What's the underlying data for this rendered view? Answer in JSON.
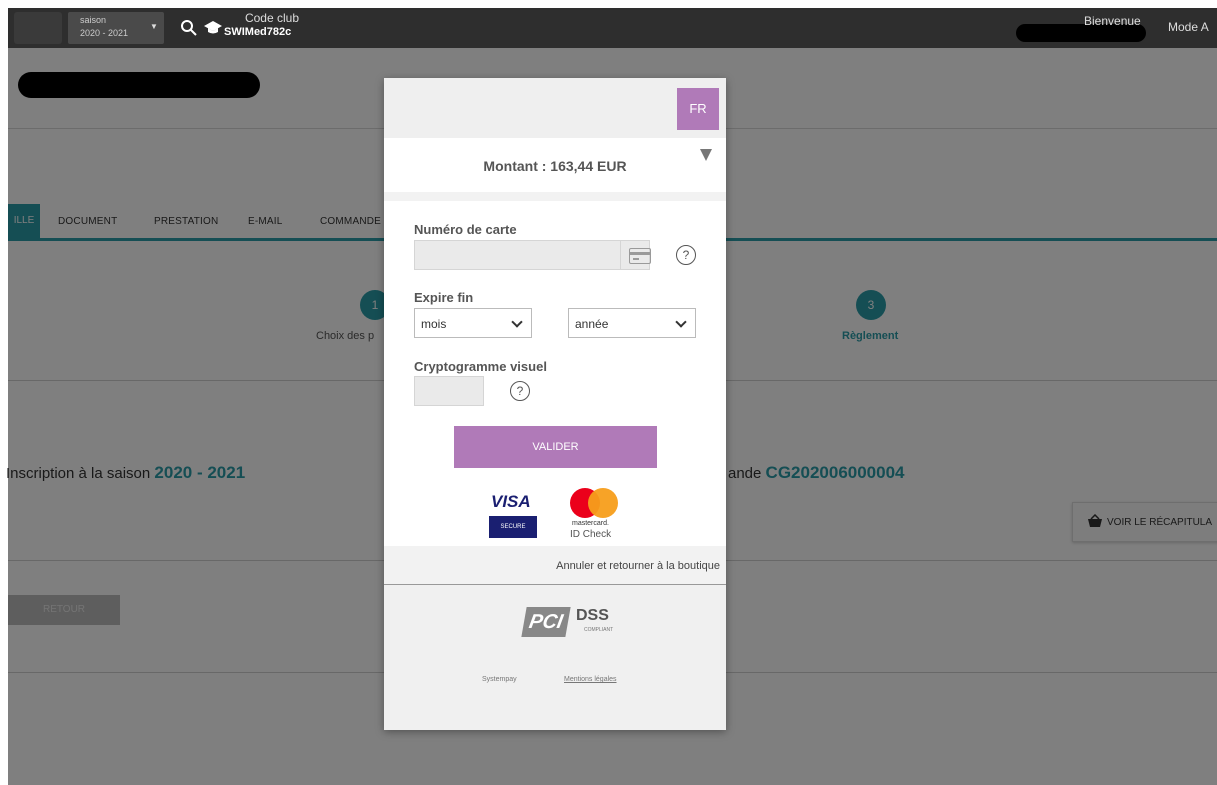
{
  "topbar": {
    "season_label": "saison",
    "season_value": "2020 - 2021",
    "club_code_label": "Code club",
    "club_code_value": "SWIMed782c",
    "welcome": "Bienvenue",
    "mode": "Mode A"
  },
  "tabs": [
    "ILLE",
    "DOCUMENT",
    "PRESTATION",
    "E-MAIL",
    "COMMANDE"
  ],
  "steps": [
    {
      "number": "1",
      "label": "Choix des p"
    },
    {
      "number": "3",
      "label": "Règlement"
    }
  ],
  "inscription": {
    "prefix": "Inscription à la saison",
    "season": "2020 - 2021"
  },
  "commande": {
    "prefix": "ande",
    "number": "CG202006000004"
  },
  "recap_button": "VOIR LE RÉCAPITULA",
  "retour_button": "RETOUR",
  "payment": {
    "lang": "FR",
    "amount": "Montant : 163,44 EUR",
    "card_number_label": "Numéro de carte",
    "expiry_label": "Expire fin",
    "month_value": "mois",
    "year_value": "année",
    "cvv_label": "Cryptogramme visuel",
    "help_glyph": "?",
    "validate_label": "VALIDER",
    "visa_word": "VISA",
    "visa_secure": "SECURE",
    "mc_small": "mastercard.",
    "mc_idcheck": "ID Check",
    "cancel_link": "Annuler et retourner à la boutique",
    "pci_mark": "PCI",
    "dss_mark": "DSS",
    "dss_sub": "COMPLIANT",
    "footer_brand": "Systempay",
    "footer_legal": "Mentions légales"
  },
  "colors": {
    "accent": "#2a9ca8",
    "payment_purple": "#b07ab8"
  }
}
